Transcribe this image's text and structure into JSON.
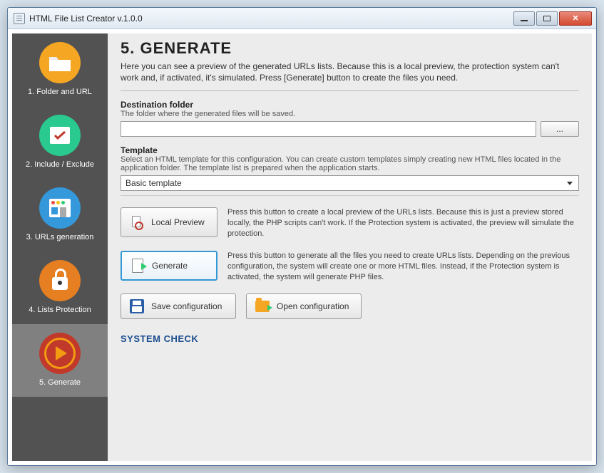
{
  "window": {
    "title": "HTML File List Creator v.1.0.0"
  },
  "sidebar": {
    "items": [
      {
        "label": "1. Folder and URL"
      },
      {
        "label": "2. Include / Exclude"
      },
      {
        "label": "3. URLs generation"
      },
      {
        "label": "4. Lists Protection"
      },
      {
        "label": "5. Generate"
      }
    ]
  },
  "main": {
    "heading": "5. GENERATE",
    "intro": "Here you can see a preview of the generated URLs lists. Because this is a local preview, the protection system can't work and, if activated, it's simulated. Press [Generate] button to create the files you need.",
    "dest": {
      "label": "Destination folder",
      "desc": "The folder where the generated files will be saved.",
      "value": "",
      "browse": "..."
    },
    "template": {
      "label": "Template",
      "desc": "Select an HTML template for this configuration. You can create custom templates simply creating new HTML files located in the application folder. The template list is prepared when the application starts.",
      "selected": "Basic template"
    },
    "preview": {
      "button": "Local Preview",
      "desc": "Press this button to create a local preview of the URLs lists. Because this is just a preview stored locally, the PHP scripts can't work. If the Protection system is activated, the preview will simulate the protection."
    },
    "generate": {
      "button": "Generate",
      "desc": "Press this button to generate all the files you need to create URLs lists. Depending on the previous configuration, the system will create one or more HTML files. Instead, if the Protection system is activated, the system will generate PHP files."
    },
    "save_btn": "Save configuration",
    "open_btn": "Open configuration",
    "syscheck": "SYSTEM CHECK"
  }
}
